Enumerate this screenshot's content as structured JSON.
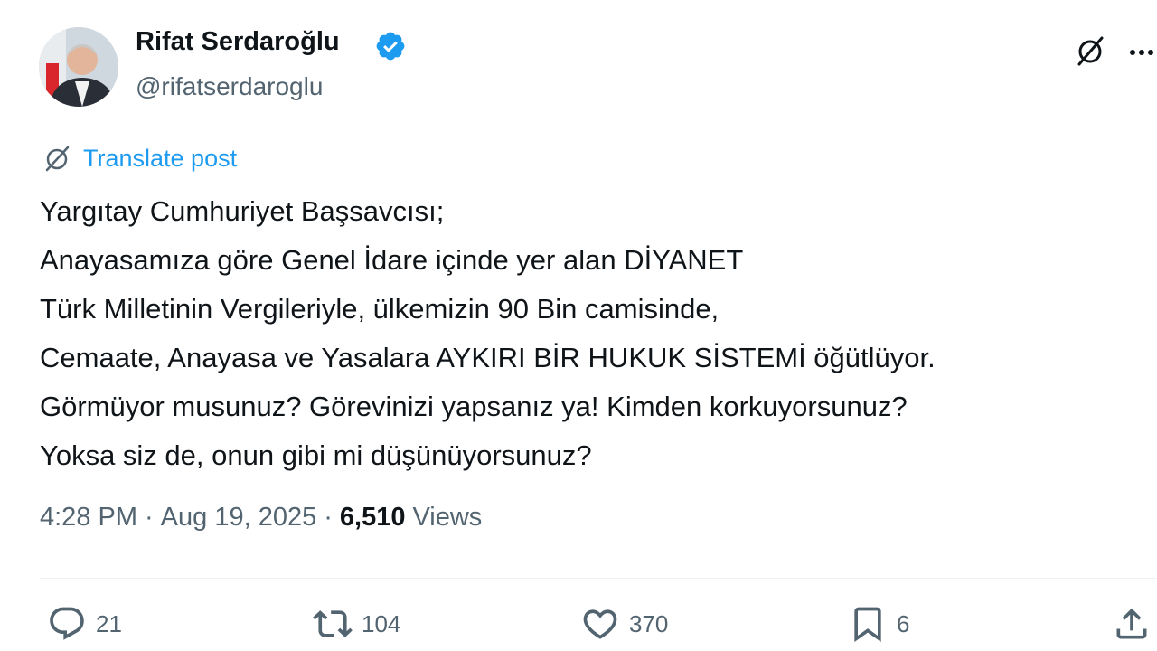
{
  "author": {
    "name": "Rifat Serdaroğlu",
    "handle": "@rifatserdaroglu",
    "verified": true
  },
  "translate": {
    "label": "Translate post"
  },
  "post": {
    "lines": [
      "Yargıtay Cumhuriyet Başsavcısı;",
      "Anayasamıza göre Genel İdare içinde yer alan DİYANET",
      "Türk Milletinin Vergileriyle, ülkemizin 90 Bin camisinde,",
      "Cemaate, Anayasa ve Yasalara AYKIRI BİR HUKUK SİSTEMİ öğütlüyor.",
      "Görmüyor musunuz? Görevinizi yapsanız ya! Kimden korkuyorsunuz?",
      "Yoksa siz de, onun gibi mi düşünüyorsunuz?"
    ]
  },
  "meta": {
    "time": "4:28 PM",
    "date": "Aug 19, 2025",
    "separator": "·",
    "views_count": "6,510",
    "views_label": "Views"
  },
  "actions": {
    "replies": "21",
    "reposts": "104",
    "likes": "370",
    "bookmarks": "6"
  },
  "colors": {
    "accent": "#1d9bf0",
    "text": "#0f1419",
    "secondary": "#536471"
  },
  "icons": {
    "verified": "verified-badge-icon",
    "grok": "grok-icon",
    "more": "more-icon",
    "translate": "translate-icon",
    "reply": "reply-icon",
    "repost": "repost-icon",
    "like": "heart-icon",
    "bookmark": "bookmark-icon",
    "share": "share-icon"
  }
}
